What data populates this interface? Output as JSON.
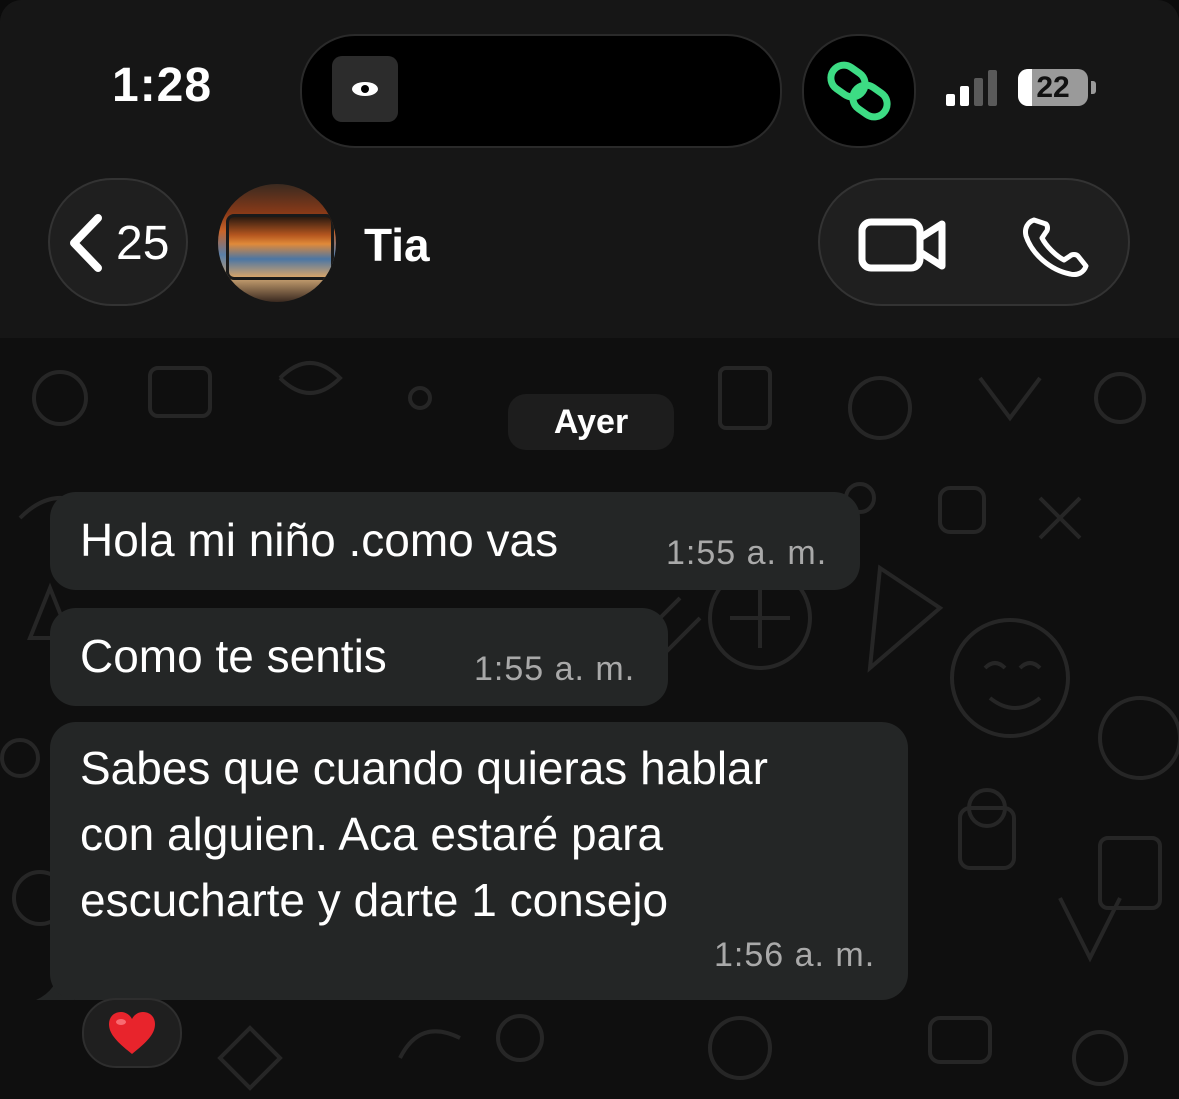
{
  "status_bar": {
    "time": "1:28",
    "battery": "22",
    "island_thumb_icon": "eye-icon",
    "island_app_icon": "link-icon"
  },
  "header": {
    "back_count": "25",
    "contact_name": "Tia",
    "back_icon": "chevron-left-icon",
    "video_icon": "video-camera-icon",
    "phone_icon": "phone-icon"
  },
  "chat": {
    "date_label": "Ayer",
    "messages": [
      {
        "text": "Hola mi niño .como vas",
        "time": "1:55 a. m."
      },
      {
        "text": "Como te sentis",
        "time": "1:55 a. m."
      },
      {
        "lines": [
          "Sabes que cuando quieras hablar",
          "con alguien. Aca estaré para",
          "escucharte y darte 1 consejo"
        ],
        "time": "1:56 a. m."
      }
    ],
    "reaction": "❤️"
  },
  "colors": {
    "bubble": "#242626",
    "accent_green": "#3ddc84",
    "background": "#0f0f0f"
  }
}
